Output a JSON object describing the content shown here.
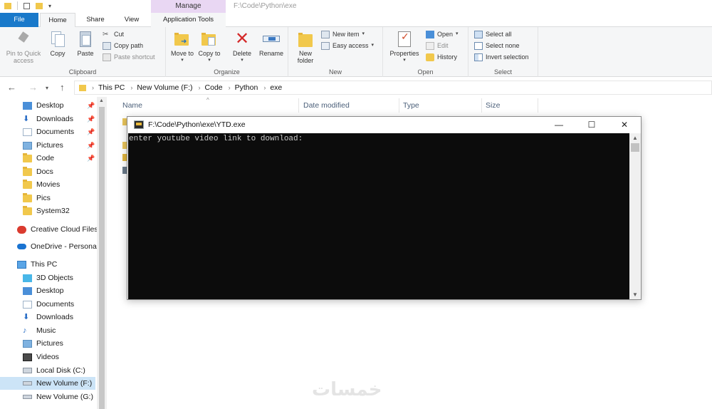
{
  "window": {
    "title_path": "F:\\Code\\Python\\exe",
    "contextual_tab_group": "Manage"
  },
  "tabs": {
    "file": "File",
    "home": "Home",
    "share": "Share",
    "view": "View",
    "application_tools": "Application Tools"
  },
  "ribbon": {
    "clipboard": {
      "label": "Clipboard",
      "pin": "Pin to Quick access",
      "copy": "Copy",
      "paste": "Paste",
      "cut": "Cut",
      "copy_path": "Copy path",
      "paste_shortcut": "Paste shortcut"
    },
    "organize": {
      "label": "Organize",
      "move_to": "Move to",
      "copy_to": "Copy to",
      "delete": "Delete",
      "rename": "Rename"
    },
    "new": {
      "label": "New",
      "new_folder": "New folder",
      "new_item": "New item",
      "easy_access": "Easy access"
    },
    "open": {
      "label": "Open",
      "properties": "Properties",
      "open": "Open",
      "edit": "Edit",
      "history": "History"
    },
    "select": {
      "label": "Select",
      "select_all": "Select all",
      "select_none": "Select none",
      "invert_selection": "Invert selection"
    }
  },
  "address": {
    "crumbs": [
      "This PC",
      "New Volume (F:)",
      "Code",
      "Python",
      "exe"
    ]
  },
  "nav": {
    "quick_access": [
      "Desktop",
      "Downloads",
      "Documents",
      "Pictures",
      "Code",
      "Docs",
      "Movies",
      "Pics",
      "System32"
    ],
    "creative_cloud": "Creative Cloud Files",
    "onedrive": "OneDrive - Personal",
    "this_pc": "This PC",
    "this_pc_items": [
      "3D Objects",
      "Desktop",
      "Documents",
      "Downloads",
      "Music",
      "Pictures",
      "Videos",
      "Local Disk (C:)",
      "New Volume (F:)",
      "New Volume (G:)"
    ]
  },
  "list_columns": {
    "name": "Name",
    "date_modified": "Date modified",
    "type": "Type",
    "size": "Size"
  },
  "console": {
    "title": "F:\\Code\\Python\\exe\\YTD.exe",
    "minimize": "—",
    "maximize": "☐",
    "close": "✕",
    "prompt": "enter youtube video link to download:"
  },
  "watermark": "خمسات"
}
